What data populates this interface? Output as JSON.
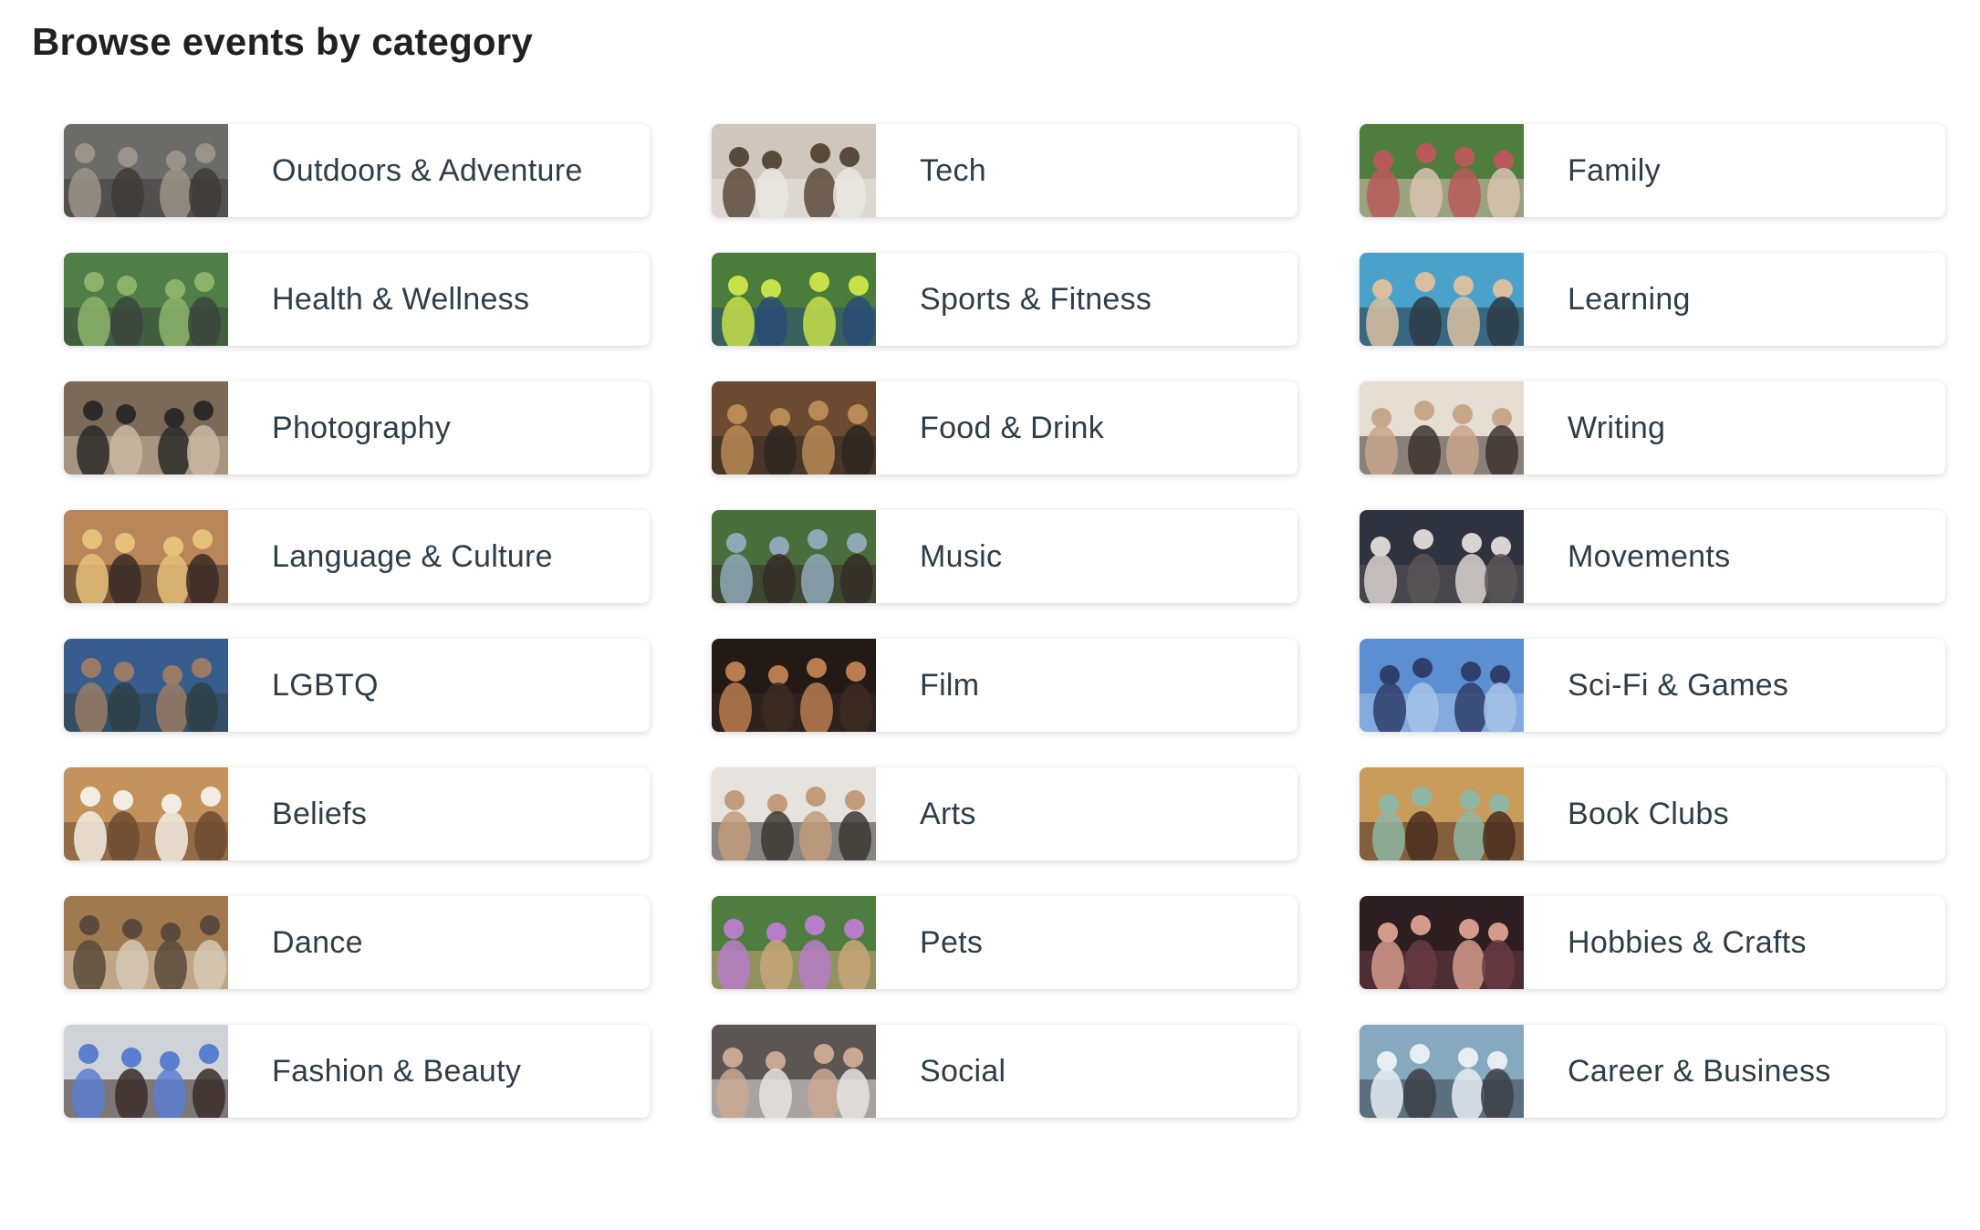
{
  "page": {
    "title": "Browse events by category"
  },
  "categories": [
    {
      "label": "Outdoors & Adventure",
      "image": "outdoors-photo",
      "colors": [
        "#6b6b68",
        "#9a938a",
        "#3c3b38"
      ]
    },
    {
      "label": "Tech",
      "image": "tech-photo",
      "colors": [
        "#cfc7bd",
        "#5a4a3c",
        "#eae6e0"
      ]
    },
    {
      "label": "Family",
      "image": "family-photo",
      "colors": [
        "#4f7d3e",
        "#b95a5a",
        "#d8c3b1"
      ]
    },
    {
      "label": "Health & Wellness",
      "image": "health-photo",
      "colors": [
        "#4f7f46",
        "#8db36b",
        "#39443d"
      ]
    },
    {
      "label": "Sports & Fitness",
      "image": "sports-photo",
      "colors": [
        "#4a7c3b",
        "#c8e04a",
        "#2a4b77"
      ]
    },
    {
      "label": "Learning",
      "image": "learning-photo",
      "colors": [
        "#4aa1c9",
        "#d8bfa2",
        "#2d3b45"
      ]
    },
    {
      "label": "Photography",
      "image": "photography-photo",
      "colors": [
        "#7b6a58",
        "#2c2a29",
        "#c9b8a4"
      ]
    },
    {
      "label": "Food & Drink",
      "image": "food-photo",
      "colors": [
        "#6b4a31",
        "#b98a55",
        "#2d2620"
      ]
    },
    {
      "label": "Writing",
      "image": "writing-photo",
      "colors": [
        "#e6ddd3",
        "#c7a68a",
        "#3d3430"
      ]
    },
    {
      "label": "Language & Culture",
      "image": "language-photo",
      "colors": [
        "#b9865a",
        "#e6c17a",
        "#3a2c25"
      ]
    },
    {
      "label": "Music",
      "image": "music-photo",
      "colors": [
        "#4b6d3c",
        "#8fa7b7",
        "#342b27"
      ]
    },
    {
      "label": "Movements",
      "image": "movements-photo",
      "colors": [
        "#2f3340",
        "#d9d4cf",
        "#5b5556"
      ]
    },
    {
      "label": "LGBTQ",
      "image": "lgbtq-photo",
      "colors": [
        "#365d8d",
        "#9a7b66",
        "#2f3f45"
      ]
    },
    {
      "label": "Film",
      "image": "film-photo",
      "colors": [
        "#231a16",
        "#b97c4f",
        "#3b2a22"
      ]
    },
    {
      "label": "Sci-Fi & Games",
      "image": "scifi-photo",
      "colors": [
        "#5c8fd1",
        "#2f3e6b",
        "#a5c3ea"
      ]
    },
    {
      "label": "Beliefs",
      "image": "beliefs-photo",
      "colors": [
        "#c4925c",
        "#f2ece2",
        "#6d4a31"
      ]
    },
    {
      "label": "Arts",
      "image": "arts-photo",
      "colors": [
        "#e6e2dd",
        "#c29b7b",
        "#3b3734"
      ]
    },
    {
      "label": "Book Clubs",
      "image": "bookclubs-photo",
      "colors": [
        "#c99c5c",
        "#8fb6a3",
        "#4a2e20"
      ]
    },
    {
      "label": "Dance",
      "image": "dance-photo",
      "colors": [
        "#a07a4e",
        "#5b4a3b",
        "#d6c9b5"
      ]
    },
    {
      "label": "Pets",
      "image": "pets-photo",
      "colors": [
        "#4e7d3f",
        "#b77dc9",
        "#c9a57a"
      ]
    },
    {
      "label": "Hobbies & Crafts",
      "image": "hobbies-photo",
      "colors": [
        "#2d1e22",
        "#d49b8b",
        "#6a3b43"
      ]
    },
    {
      "label": "Fashion & Beauty",
      "image": "fashion-photo",
      "colors": [
        "#cfd3d8",
        "#5a7ed0",
        "#3b2c28"
      ]
    },
    {
      "label": "Social",
      "image": "social-photo",
      "colors": [
        "#5b5553",
        "#c9a893",
        "#e8e4e0"
      ]
    },
    {
      "label": "Career & Business",
      "image": "career-photo",
      "colors": [
        "#86a9c0",
        "#e6eef4",
        "#3b3f47"
      ]
    }
  ]
}
